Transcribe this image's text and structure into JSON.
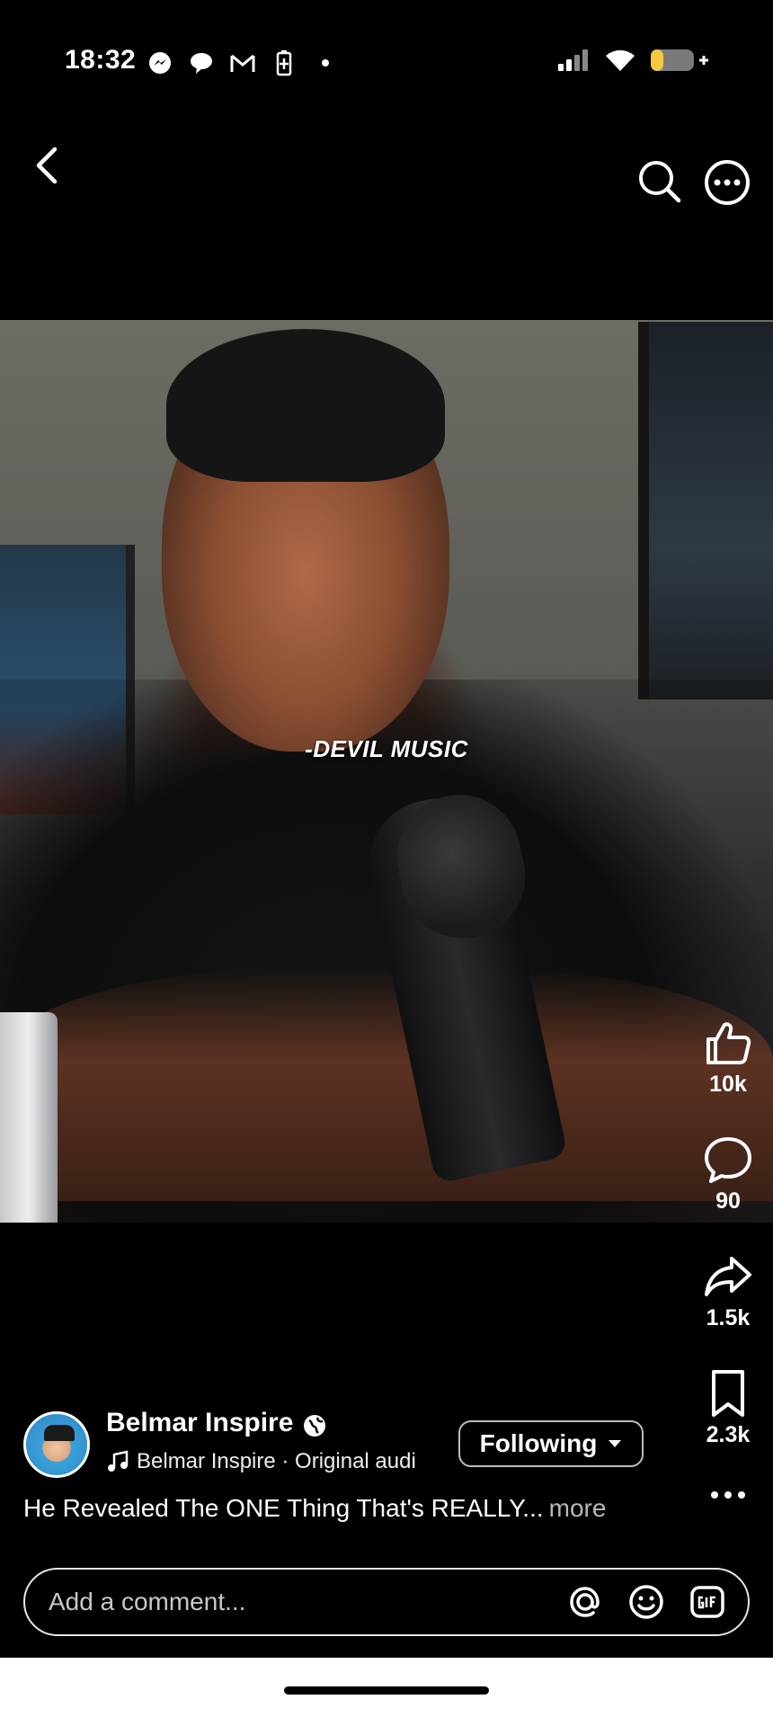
{
  "status_bar": {
    "time": "18:32",
    "left_icons": [
      "messenger-icon",
      "chat-bubble-icon",
      "gmail-icon",
      "battery-saver-icon",
      "dot-icon"
    ],
    "right_icons": [
      "signal-icon",
      "wifi-icon",
      "battery-icon"
    ],
    "battery_color": "#f5c842"
  },
  "nav": {
    "back_icon": "chevron-left-icon",
    "search_icon": "search-icon",
    "more_icon": "more-circle-icon"
  },
  "video": {
    "overlay_text": "-DEVIL MUSIC"
  },
  "actions": {
    "like": {
      "icon": "thumbs-up-icon",
      "count": "10k"
    },
    "comment": {
      "icon": "comment-icon",
      "count": "90"
    },
    "share": {
      "icon": "share-icon",
      "count": "1.5k"
    },
    "save": {
      "icon": "bookmark-icon",
      "count": "2.3k"
    },
    "more": {
      "icon": "more-horizontal-icon"
    }
  },
  "post": {
    "author": "Belmar Inspire",
    "visibility_icon": "globe-icon",
    "audio": "Belmar Inspire · Original audi",
    "follow_label": "Following",
    "caption": "He Revealed The ONE Thing That's REALLY...",
    "more_label": "more"
  },
  "comment_box": {
    "placeholder": "Add a comment...",
    "icons": [
      "mention-icon",
      "emoji-icon",
      "gif-icon"
    ]
  }
}
